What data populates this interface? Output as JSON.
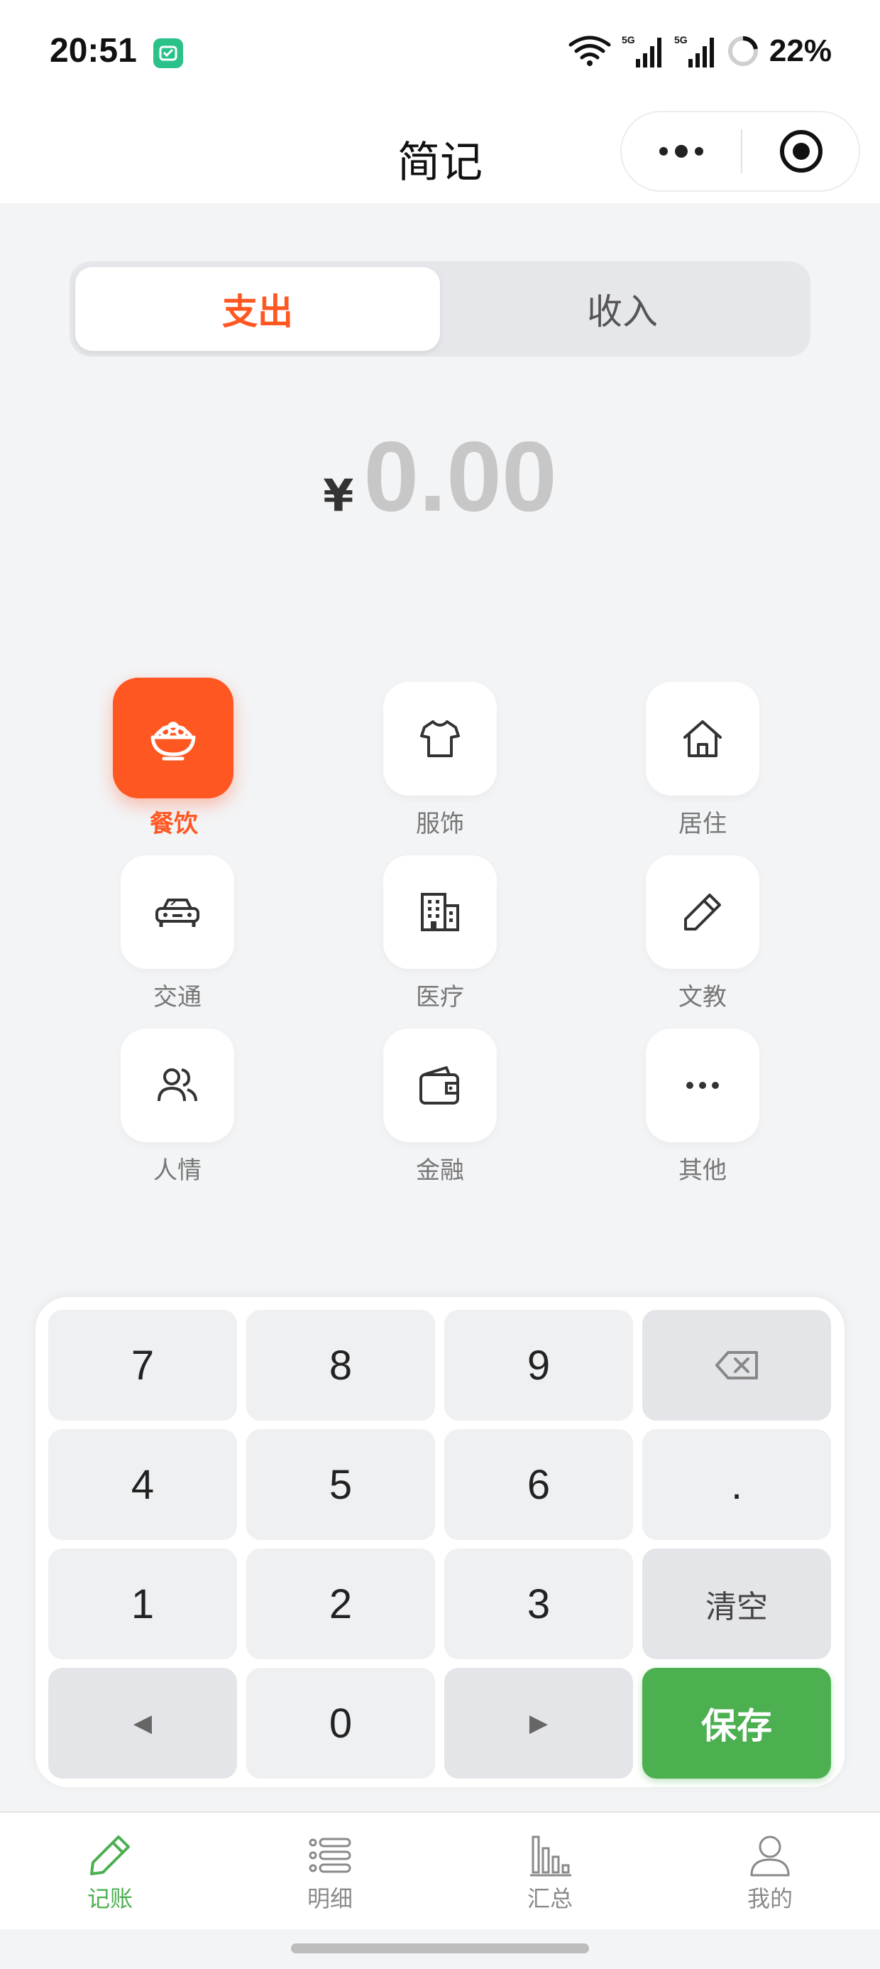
{
  "status_bar": {
    "time": "20:51",
    "battery": "22%",
    "network": "5G",
    "icons": [
      "wifi-icon",
      "signal-5g-icon",
      "signal-5g-icon",
      "battery-ring-icon"
    ]
  },
  "header": {
    "title": "简记",
    "capsule_icons": [
      "more-dots-icon",
      "close-target-icon"
    ]
  },
  "toggle": {
    "expense": "支出",
    "income": "收入",
    "active": "expense"
  },
  "amount": {
    "currency": "¥",
    "value": "0.00"
  },
  "categories": [
    {
      "label": "餐饮",
      "icon": "bowl-icon",
      "selected": true
    },
    {
      "label": "服饰",
      "icon": "tshirt-icon",
      "selected": false
    },
    {
      "label": "居住",
      "icon": "house-icon",
      "selected": false
    },
    {
      "label": "交通",
      "icon": "car-icon",
      "selected": false
    },
    {
      "label": "医疗",
      "icon": "building-icon",
      "selected": false
    },
    {
      "label": "文教",
      "icon": "pencil-icon",
      "selected": false
    },
    {
      "label": "人情",
      "icon": "people-icon",
      "selected": false
    },
    {
      "label": "金融",
      "icon": "wallet-icon",
      "selected": false
    },
    {
      "label": "其他",
      "icon": "more-icon",
      "selected": false
    }
  ],
  "keypad": {
    "k7": "7",
    "k8": "8",
    "k9": "9",
    "k4": "4",
    "k5": "5",
    "k6": "6",
    "dot": ".",
    "k1": "1",
    "k2": "2",
    "k3": "3",
    "clear": "清空",
    "left": "◀",
    "k0": "0",
    "right": "▶",
    "save": "保存",
    "backspace_icon": "backspace-icon"
  },
  "tabbar": {
    "items": [
      {
        "label": "记账",
        "icon": "pencil-tab-icon",
        "active": true
      },
      {
        "label": "明细",
        "icon": "list-icon",
        "active": false
      },
      {
        "label": "汇总",
        "icon": "bar-chart-icon",
        "active": false
      },
      {
        "label": "我的",
        "icon": "user-icon",
        "active": false
      }
    ]
  },
  "colors": {
    "accent": "#ff5722",
    "save": "#4caf50",
    "background": "#f3f4f6"
  }
}
